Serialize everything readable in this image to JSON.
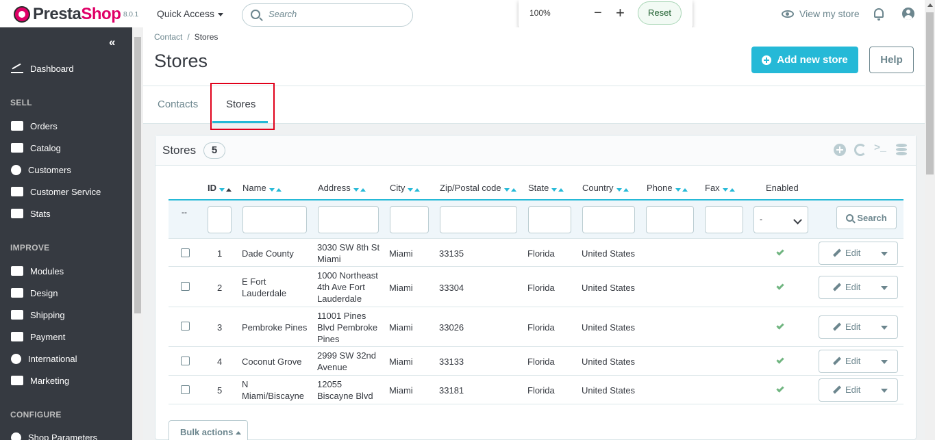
{
  "header": {
    "logo_prefix": "Presta",
    "logo_suffix": "Shop",
    "version": "8.0.1",
    "quick_access": "Quick Access",
    "search_placeholder": "Search",
    "zoom": {
      "value": "100%",
      "minus": "−",
      "plus": "+",
      "reset": "Reset"
    },
    "view_store": "View my store"
  },
  "sidebar": {
    "collapse": "«",
    "items": [
      {
        "label": "Dashboard",
        "icon": "trending-up-icon"
      },
      {
        "section": "SELL"
      },
      {
        "label": "Orders",
        "icon": "basket-icon"
      },
      {
        "label": "Catalog",
        "icon": "store-icon"
      },
      {
        "label": "Customers",
        "icon": "account-circle-icon"
      },
      {
        "label": "Customer Service",
        "icon": "chat-icon"
      },
      {
        "label": "Stats",
        "icon": "bar-chart-icon"
      },
      {
        "section": "IMPROVE"
      },
      {
        "label": "Modules",
        "icon": "puzzle-icon"
      },
      {
        "label": "Design",
        "icon": "desktop-icon"
      },
      {
        "label": "Shipping",
        "icon": "truck-icon"
      },
      {
        "label": "Payment",
        "icon": "credit-card-icon"
      },
      {
        "label": "International",
        "icon": "globe-icon"
      },
      {
        "label": "Marketing",
        "icon": "megaphone-icon"
      },
      {
        "section": "CONFIGURE"
      },
      {
        "label": "Shop Parameters",
        "icon": "settings-icon"
      }
    ]
  },
  "page": {
    "breadcrumb": {
      "parent": "Contact",
      "separator": "/",
      "current": "Stores"
    },
    "title": "Stores",
    "add_button": "Add new store",
    "help_button": "Help"
  },
  "tabs": [
    {
      "label": "Contacts",
      "active": false
    },
    {
      "label": "Stores",
      "active": true
    }
  ],
  "panel": {
    "title": "Stores",
    "count": "5",
    "tool_sql": ">_"
  },
  "table": {
    "columns": [
      "ID",
      "Name",
      "Address",
      "City",
      "Zip/Postal code",
      "State",
      "Country",
      "Phone",
      "Fax",
      "Enabled"
    ],
    "filter_dash": "--",
    "enabled_filter": "-",
    "search_button": "Search",
    "rows": [
      {
        "id": "1",
        "name": "Dade County",
        "address": "3030 SW 8th St Miami",
        "city": "Miami",
        "zip": "33135",
        "state": "Florida",
        "country": "United States",
        "phone": "",
        "fax": "",
        "enabled": true,
        "action": "Edit"
      },
      {
        "id": "2",
        "name": "E Fort Lauderdale",
        "address": "1000 Northeast 4th Ave Fort Lauderdale",
        "city": "Miami",
        "zip": "33304",
        "state": "Florida",
        "country": "United States",
        "phone": "",
        "fax": "",
        "enabled": true,
        "action": "Edit"
      },
      {
        "id": "3",
        "name": "Pembroke Pines",
        "address": "11001 Pines Blvd Pembroke Pines",
        "city": "Miami",
        "zip": "33026",
        "state": "Florida",
        "country": "United States",
        "phone": "",
        "fax": "",
        "enabled": true,
        "action": "Edit"
      },
      {
        "id": "4",
        "name": "Coconut Grove",
        "address": "2999 SW 32nd Avenue",
        "city": "Miami",
        "zip": "33133",
        "state": "Florida",
        "country": "United States",
        "phone": "",
        "fax": "",
        "enabled": true,
        "action": "Edit"
      },
      {
        "id": "5",
        "name": "N Miami/Biscayne",
        "address": "12055 Biscayne Blvd",
        "city": "Miami",
        "zip": "33181",
        "state": "Florida",
        "country": "United States",
        "phone": "",
        "fax": "",
        "enabled": true,
        "action": "Edit"
      }
    ]
  },
  "bulk_actions": "Bulk actions",
  "colors": {
    "accent": "#25b9d7",
    "sidebar": "#363a41",
    "brand": "#df0067",
    "success": "#70b580",
    "highlight": "#e0001a"
  }
}
